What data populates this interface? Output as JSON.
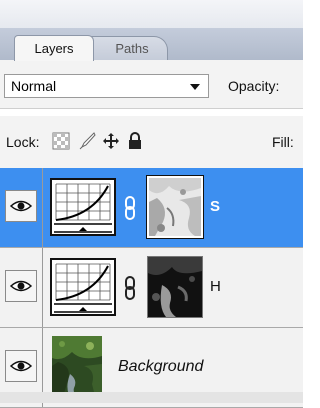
{
  "panel": {
    "tabs": [
      {
        "label": "Layers",
        "active": true
      },
      {
        "label": "Paths",
        "active": false
      }
    ]
  },
  "options": {
    "blend_mode": "Normal",
    "opacity_label": "Opacity:",
    "lock_label": "Lock:",
    "fill_label": "Fill:",
    "lock_icons": [
      "lock-transparent-pixels-icon",
      "lock-image-pixels-icon",
      "lock-position-icon",
      "lock-all-icon"
    ]
  },
  "layers": [
    {
      "name": "S",
      "type": "curves-adjustment",
      "selected": true,
      "visible": true,
      "has_mask": true,
      "mask_selected": true
    },
    {
      "name": "H",
      "type": "curves-adjustment",
      "selected": false,
      "visible": true,
      "has_mask": true
    },
    {
      "name": "Background",
      "type": "image",
      "selected": false,
      "visible": true,
      "italic": true
    }
  ],
  "colors": {
    "selection": "#3d8ff0",
    "tab_bar": "#b8c1d1",
    "panel_bg": "#f2f2f2"
  }
}
